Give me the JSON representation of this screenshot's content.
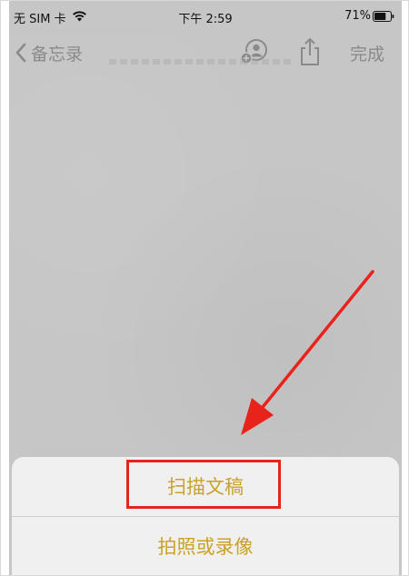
{
  "status_bar": {
    "carrier": "无 SIM 卡",
    "time": "下午 2:59",
    "battery": "71%"
  },
  "nav": {
    "back_label": "备忘录",
    "done_label": "完成",
    "icons": [
      "chevron-left-icon",
      "add-people-icon",
      "share-icon"
    ]
  },
  "action_sheet": {
    "items": [
      {
        "label": "扫描文稿"
      },
      {
        "label": "拍照或录像"
      }
    ]
  },
  "annotation": {
    "color": "#e8231c",
    "highlight_target": "扫描文稿"
  },
  "colors": {
    "accent": "#c9a227",
    "nav_text": "#8a8a8a",
    "background": "#c6c6c6"
  }
}
